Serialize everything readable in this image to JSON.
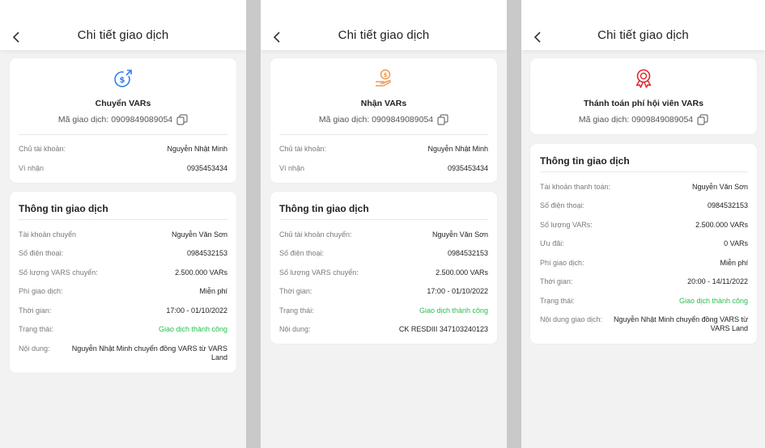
{
  "screens": [
    {
      "header": {
        "title": "Chi tiết giao dịch"
      },
      "top_card": {
        "icon": "dollar-transfer-icon",
        "title": "Chuyển VARs",
        "code_text": "Mã giao dịch: 0909849089054",
        "rows": [
          {
            "label": "Chủ tài khoản:",
            "value": "Nguyễn Nhật Minh"
          },
          {
            "label": "Ví nhận",
            "value": "0935453434"
          }
        ]
      },
      "info_card": {
        "title": "Thông tin giao dịch",
        "rows": [
          {
            "label": "Tài khoản chuyển",
            "value": "Nguyễn Văn Sơn"
          },
          {
            "label": "Số điện thoại:",
            "value": "0984532153"
          },
          {
            "label": "Số lượng VARS chuyển:",
            "value": "2.500.000 VARs"
          },
          {
            "label": "Phí giao dịch:",
            "value": "Miễn phí"
          },
          {
            "label": "Thời gian:",
            "value": "17:00 - 01/10/2022"
          },
          {
            "label": "Trạng thái:",
            "value": "Giao dịch thành công"
          },
          {
            "label": "Nội dung:",
            "value": "Nguyễn Nhật Minh chuyển đồng VARS từ VARS Land"
          }
        ]
      }
    },
    {
      "header": {
        "title": "Chi tiết giao dịch"
      },
      "top_card": {
        "icon": "hand-coin-icon",
        "title": "Nhận VARs",
        "code_text": "Mã giao dịch: 0909849089054",
        "rows": [
          {
            "label": "Chủ tài khoản:",
            "value": "Nguyễn Nhật Minh"
          },
          {
            "label": "Ví nhận",
            "value": "0935453434"
          }
        ]
      },
      "info_card": {
        "title": "Thông tin giao dịch",
        "rows": [
          {
            "label": "Chủ tài khoản chuyển:",
            "value": "Nguyễn Văn Sơn"
          },
          {
            "label": "Số điện thoại:",
            "value": "0984532153"
          },
          {
            "label": "Số lượng VARS chuyển:",
            "value": "2.500.000 VARs"
          },
          {
            "label": "Thời gian:",
            "value": "17:00 - 01/10/2022"
          },
          {
            "label": "Trạng thái:",
            "value": "Giao dịch thành công"
          },
          {
            "label": "Nội dung:",
            "value": "CK RESDIII 347103240123"
          }
        ]
      }
    },
    {
      "header": {
        "title": "Chi tiết giao dịch"
      },
      "top_card": {
        "icon": "award-badge-icon",
        "title": "Thánh toán phí hội viên VARs",
        "code_text": "Mã giao dịch: 0909849089054"
      },
      "info_card": {
        "title": "Thông tin giao dịch",
        "rows": [
          {
            "label": "Tài khoản thanh toán:",
            "value": "Nguyễn Văn Sơn"
          },
          {
            "label": "Số điện thoại:",
            "value": "0984532153"
          },
          {
            "label": "Số lượng VARs:",
            "value": "2.500.000 VARs"
          },
          {
            "label": "Ưu đãi:",
            "value": "0 VARs"
          },
          {
            "label": "Phí giao dịch:",
            "value": "Miễn phí"
          },
          {
            "label": "Thời gian:",
            "value": "20:00 - 14/11/2022"
          },
          {
            "label": "Trạng thái:",
            "value": "Giao dịch thành công"
          },
          {
            "label": "Nội dung giao dịch:",
            "value": "Nguyễn Nhật Minh chuyển đồng VARS từ VARS Land"
          }
        ]
      }
    }
  ],
  "colors": {
    "success": "#27c24c",
    "transfer_icon": "#2f80ed",
    "receive_icon": "#f2994a",
    "award_icon": "#e0282e"
  }
}
